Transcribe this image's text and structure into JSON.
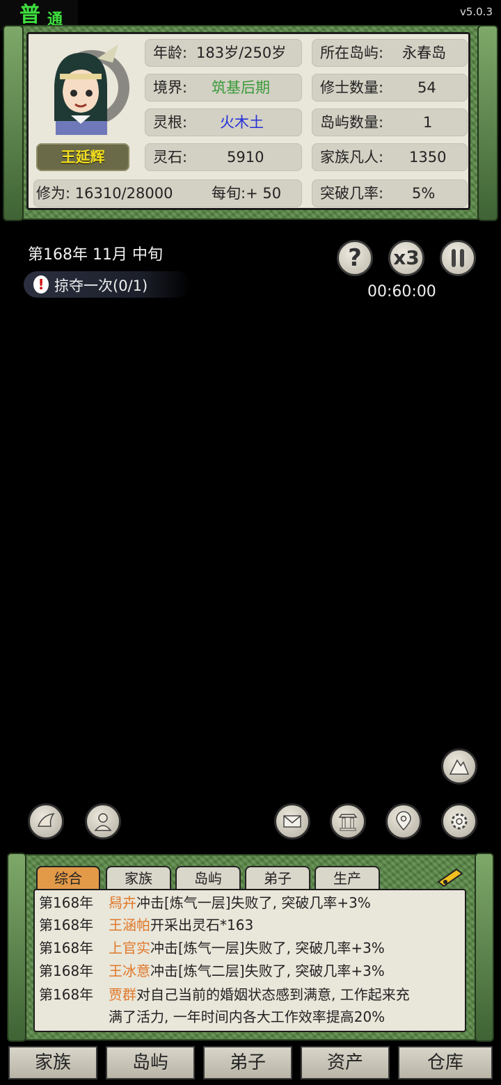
{
  "difficulty": {
    "big": "普",
    "small": "通"
  },
  "version": "v5.0.3",
  "character": {
    "name": "王延辉"
  },
  "stats": {
    "age_label": "年龄:",
    "age_value": "183岁/250岁",
    "realm_label": "境界:",
    "realm_value": "筑基后期",
    "root_label": "灵根:",
    "root_value": "火木土",
    "stone_label": "灵石:",
    "stone_value": "5910",
    "cultivation": "修为:  16310/28000",
    "per_period": "每旬:+  50",
    "island_label": "所在岛屿:",
    "island_value": "永春岛",
    "cultivators_label": "修士数量:",
    "cultivators_value": "54",
    "islands_label": "岛屿数量:",
    "islands_value": "1",
    "mortals_label": "家族凡人:",
    "mortals_value": "1350",
    "breakthrough_label": "突破几率:",
    "breakthrough_value": "5%"
  },
  "date": "第168年 11月 中旬",
  "task": "掠夺一次(0/1)",
  "timer": "00:60:00",
  "controls": {
    "help": "?",
    "speed": "x3"
  },
  "tabs": [
    "综合",
    "家族",
    "岛屿",
    "弟子",
    "生产"
  ],
  "log": [
    {
      "year": "第168年",
      "name": "舄卉",
      "text": "冲击[炼气一层]失败了, 突破几率+3%"
    },
    {
      "year": "第168年",
      "name": "王涵帕",
      "text": "开采出灵石*163"
    },
    {
      "year": "第168年",
      "name": "上官实",
      "text": "冲击[炼气一层]失败了, 突破几率+3%"
    },
    {
      "year": "第168年",
      "name": "王冰意",
      "text": "冲击[炼气二层]失败了, 突破几率+3%"
    },
    {
      "year": "第168年",
      "name": "贾群",
      "text": "对自己当前的婚姻状态感到满意, 工作起来充"
    },
    {
      "year": "",
      "name": "",
      "text": "满了活力, 一年时间内各大工作效率提高20%"
    }
  ],
  "nav": [
    "家族",
    "岛屿",
    "弟子",
    "资产",
    "仓库"
  ],
  "colors": {
    "realm": "#3a9a3a",
    "root": "#2430d8",
    "name": "#f5e020",
    "log_name": "#e0792a",
    "active_tab": "#e39a48"
  }
}
